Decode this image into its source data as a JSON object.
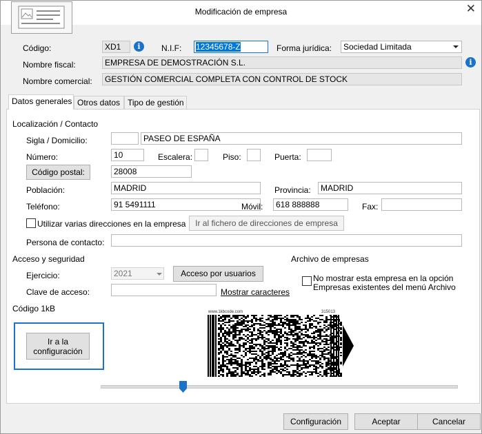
{
  "window": {
    "title": "Modificación de empresa",
    "close_glyph": "✕"
  },
  "header": {
    "codigo_label": "Código:",
    "codigo_value": "XD1",
    "nif_label": "N.I.F:",
    "nif_value": "12345678-Z",
    "forma_label": "Forma jurídica:",
    "forma_value": "Sociedad Limitada",
    "nombre_fiscal_label": "Nombre fiscal:",
    "nombre_fiscal_value": "EMPRESA DE DEMOSTRACIÓN S.L.",
    "nombre_comercial_label": "Nombre comercial:",
    "nombre_comercial_value": "GESTIÓN COMERCIAL COMPLETA CON CONTROL DE STOCK",
    "info_glyph": "i"
  },
  "tabs": [
    {
      "label": "Datos generales"
    },
    {
      "label": "Otros datos"
    },
    {
      "label": "Tipo de gestión"
    }
  ],
  "localizacion": {
    "section_title": "Localización / Contacto",
    "sigla_label": "Sigla / Domicilio:",
    "sigla_value": "",
    "domicilio_value": "PASEO DE ESPAÑA",
    "numero_label": "Número:",
    "numero_value": "10",
    "escalera_label": "Escalera:",
    "escalera_value": "",
    "piso_label": "Piso:",
    "piso_value": "",
    "puerta_label": "Puerta:",
    "puerta_value": "",
    "cp_button": "Código postal:",
    "cp_value": "28008",
    "poblacion_label": "Población:",
    "poblacion_value": "MADRID",
    "provincia_label": "Provincia:",
    "provincia_value": "MADRID",
    "telefono_label": "Teléfono:",
    "telefono_value": "91 5491111",
    "movil_label": "Móvil:",
    "movil_value": "618 888888",
    "fax_label": "Fax:",
    "fax_value": "",
    "varias_label": "Utilizar varias direcciones en la empresa",
    "fichero_button": "Ir al fichero de direcciones de empresa",
    "contacto_label": "Persona de contacto:",
    "contacto_value": ""
  },
  "acceso": {
    "section_title": "Acceso y seguridad",
    "ejercicio_label": "Ejercicio:",
    "ejercicio_value": "2021",
    "usuarios_button": "Acceso por usuarios",
    "clave_label": "Clave de acceso:",
    "clave_value": "",
    "mostrar_link": "Mostrar caracteres"
  },
  "archivo": {
    "section_title": "Archivo de empresas",
    "no_mostrar_line1": "No mostrar esta empresa en la opción",
    "no_mostrar_line2": "Empresas existentes del menú Archivo"
  },
  "codigo1kb": {
    "section_title": "Código 1kB",
    "config_button_line1": "Ir a la",
    "config_button_line2": "configuración",
    "barcode_url": "www.1kbcode.com",
    "barcode_id": "315013"
  },
  "slider": {
    "position_fraction": 0.23
  },
  "footer": {
    "configuracion": "Configuración",
    "aceptar": "Aceptar",
    "cancelar": "Cancelar"
  },
  "colors": {
    "accent": "#1a73c8",
    "nif_selection": "#0078d7",
    "focus_border": "#1a73c8"
  }
}
